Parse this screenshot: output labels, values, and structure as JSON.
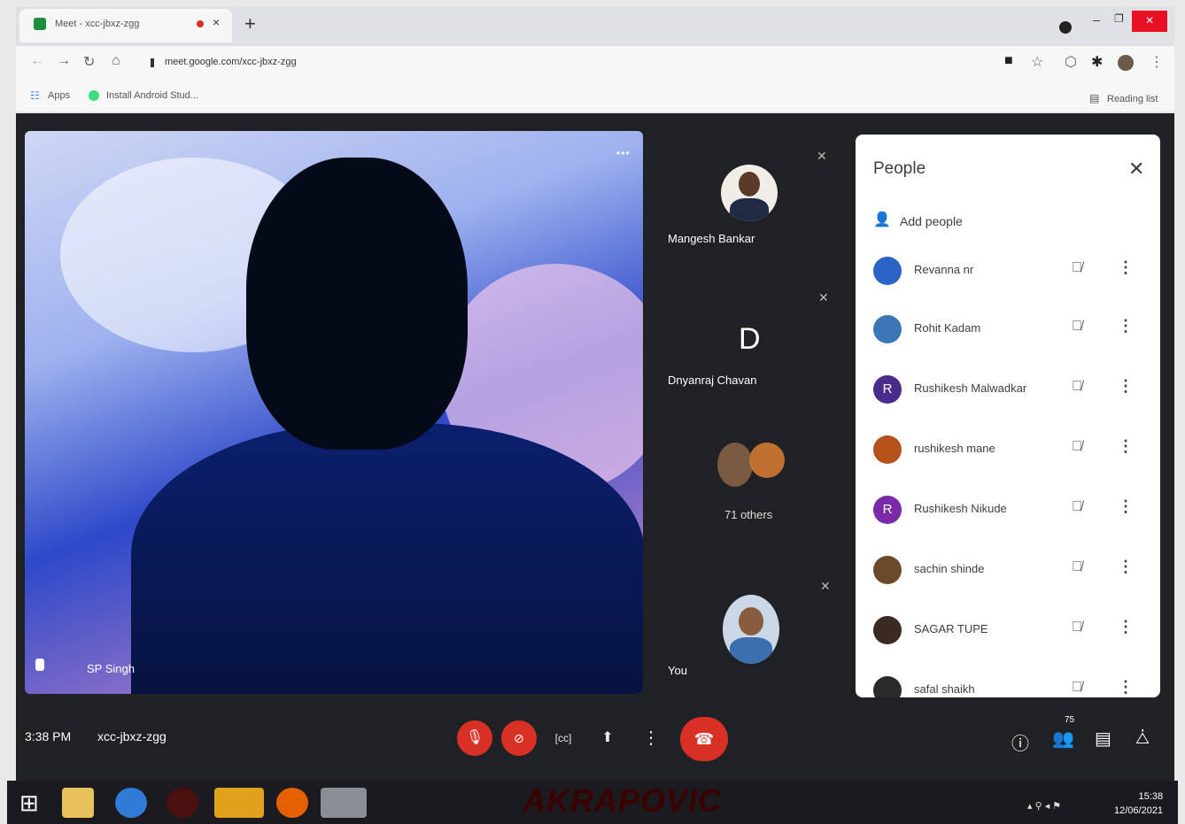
{
  "browser": {
    "tab_title": "Meet - xcc-jbxz-zgg",
    "new_tab": "+",
    "address": "meet.google.com/xcc-jbxz-zgg",
    "bookmarks": [
      "Apps",
      "Install Android Stud..."
    ],
    "reading_list": "Reading list",
    "window_close": "×"
  },
  "meet": {
    "main_tile_name": "SP Singh",
    "tiles": [
      {
        "name": "Mangesh Bankar"
      },
      {
        "name": "Dnyanraj Chavan",
        "initial": "D"
      },
      {
        "name": "71 others"
      },
      {
        "name": "You"
      }
    ],
    "time": "3:38 PM",
    "meeting_code": "xcc-jbxz-zgg",
    "participant_count": "75"
  },
  "people_panel": {
    "title": "People",
    "add_people": "Add people",
    "participants": [
      {
        "name": "Revanna nr",
        "initial": "",
        "color": "#2b63c6"
      },
      {
        "name": "Rohit Kadam",
        "initial": "",
        "color": "#3a76b8"
      },
      {
        "name": "Rushikesh Malwadkar",
        "initial": "R",
        "color": "#4a2a8a"
      },
      {
        "name": "rushikesh mane",
        "initial": "",
        "color": "#b5521c"
      },
      {
        "name": "Rushikesh Nikude",
        "initial": "R",
        "color": "#7a2aa8"
      },
      {
        "name": "sachin shinde",
        "initial": "",
        "color": "#6a4a2a"
      },
      {
        "name": "SAGAR TUPE",
        "initial": "",
        "color": "#3a2a20"
      },
      {
        "name": "safal shaikh",
        "initial": "",
        "color": "#2a2a2a"
      }
    ]
  },
  "taskbar": {
    "clock_time": "15:38",
    "clock_date": "12/06/2021",
    "wallpaper_text": "AKRAPOVIC"
  },
  "colors": {
    "meet_bg": "#202124",
    "end_call": "#d93025",
    "panel_bg": "#ffffff"
  }
}
